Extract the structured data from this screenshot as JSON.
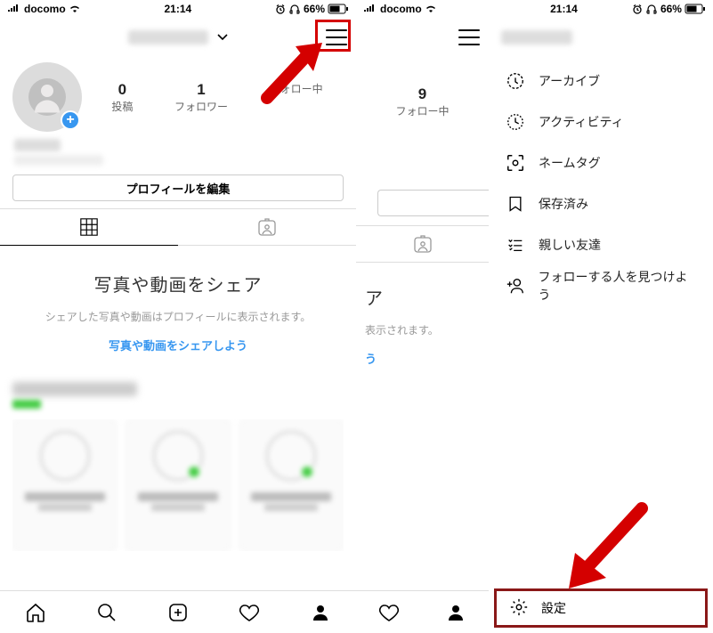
{
  "status": {
    "carrier": "docomo",
    "time": "21:14",
    "battery_pct": "66%"
  },
  "profile": {
    "stats": {
      "posts_num": "0",
      "posts_label": "投稿",
      "followers_num": "1",
      "followers_label": "フォロワー",
      "following_num": "",
      "following_label": "フォロー中",
      "peek_following_num": "9",
      "peek_following_label": "フォロー中"
    },
    "edit_btn": "プロフィールを編集"
  },
  "empty": {
    "title": "写真や動画をシェア",
    "sub": "シェアした写真や動画はプロフィールに表示されます。",
    "link": "写真や動画をシェアしよう",
    "peek_title": "ア",
    "peek_sub": "表示されます。",
    "peek_link": "う"
  },
  "menu": {
    "archive": "アーカイブ",
    "activity": "アクティビティ",
    "nametag": "ネームタグ",
    "saved": "保存済み",
    "close_friends": "親しい友達",
    "discover": "フォローする人を見つけよう",
    "settings": "設定"
  }
}
